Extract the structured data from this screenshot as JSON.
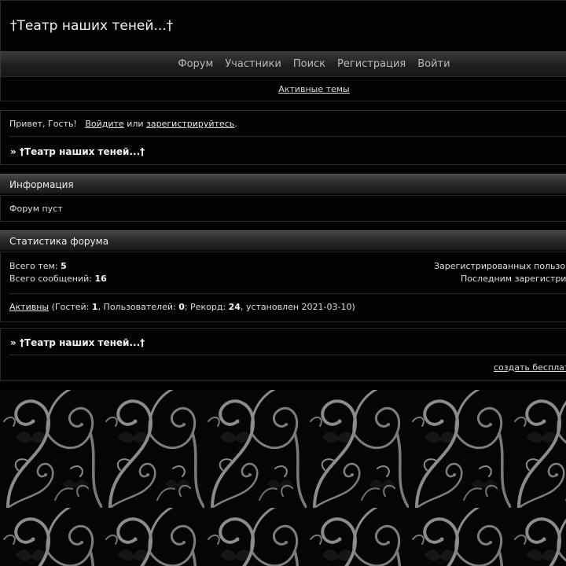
{
  "site": {
    "title": "†Театр наших теней...†"
  },
  "nav": {
    "items": [
      "Форум",
      "Участники",
      "Поиск",
      "Регистрация",
      "Войти"
    ],
    "active_topics": "Активные темы"
  },
  "welcome": {
    "greeting": "Привет, Гость!",
    "login": "Войдите",
    "or": "или",
    "register": "зарегистрируйтесь",
    "period": "."
  },
  "breadcrumb": {
    "text": "» †Театр наших теней...†"
  },
  "info": {
    "header": "Информация",
    "body": "Форум пуст"
  },
  "stats": {
    "header": "Статистика форума",
    "topics_label": "Всего тем:",
    "topics_value": "5",
    "posts_label": "Всего сообщений:",
    "posts_value": "16",
    "registered_label": "Зарегистрированных пользо",
    "last_registered_label": "Последним зарегистри",
    "active_link": "Активны",
    "guests_label": "(Гостей:",
    "guests_value": "1",
    "users_label": ", Пользователей:",
    "users_value": "0",
    "record_label": "; Рекорд:",
    "record_value": "24",
    "record_date": ", установлен 2021-03-10)"
  },
  "footer": {
    "breadcrumb": "» †Театр наших теней...†",
    "create_link": "создать бесплат"
  },
  "colors": {
    "background": "#000000",
    "nav_text": "#b9b9b9",
    "swirl": "#8a8a8a"
  }
}
